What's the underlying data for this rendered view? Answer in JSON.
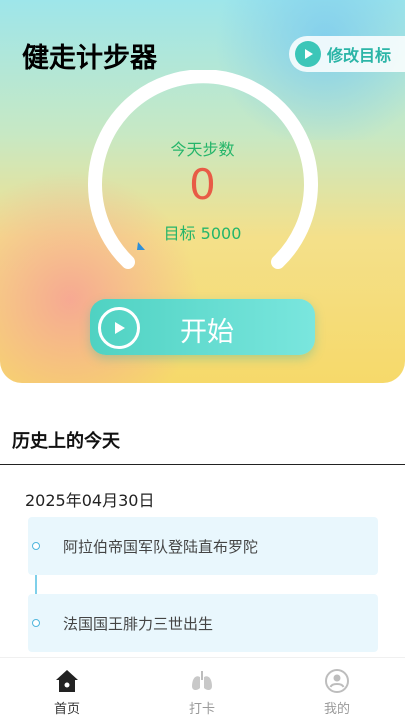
{
  "header": {
    "title": "健走计步器",
    "goal_button_label": "修改目标"
  },
  "counter": {
    "today_label": "今天步数",
    "steps": "0",
    "target_label": "目标 5000",
    "progress": 0
  },
  "start_button": {
    "label": "开始"
  },
  "history": {
    "section_title": "历史上的今天",
    "date": "2025年04月30日",
    "events": [
      {
        "text": "阿拉伯帝国军队登陆直布罗陀"
      },
      {
        "text": "法国国王腓力三世出生"
      }
    ]
  },
  "tabbar": {
    "tabs": [
      {
        "label": "首页",
        "icon": "home-icon",
        "active": true
      },
      {
        "label": "打卡",
        "icon": "lungs-icon",
        "active": false
      },
      {
        "label": "我的",
        "icon": "profile-icon",
        "active": false
      }
    ]
  },
  "colors": {
    "accent": "#3cc6b8",
    "steps": "#e85b46",
    "green_text": "#25b56a",
    "timeline": "#7fd0ea"
  }
}
